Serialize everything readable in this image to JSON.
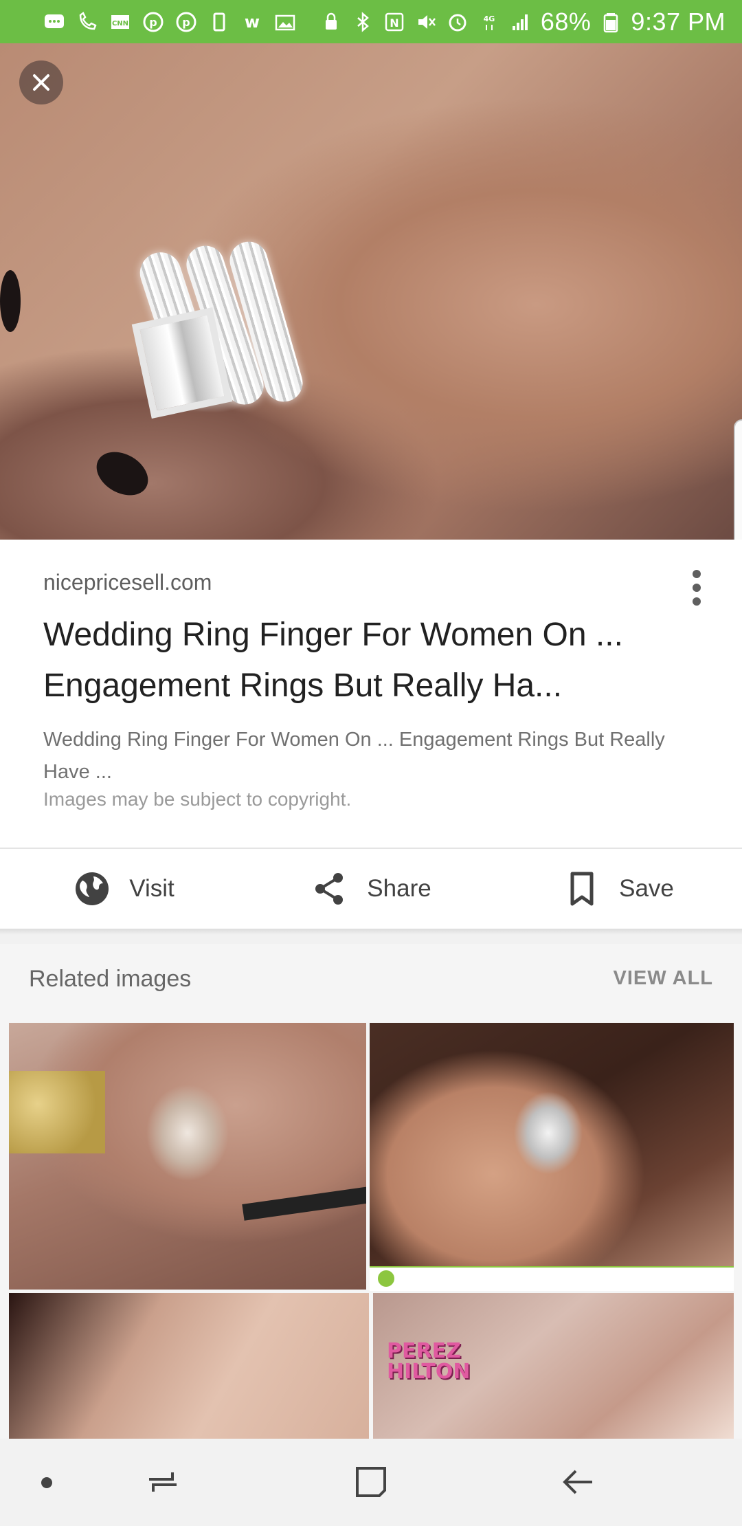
{
  "status_bar": {
    "battery_percent": "68%",
    "time": "9:37 PM",
    "icons": [
      "chat-icon",
      "missed-call-icon",
      "cnn-icon",
      "pinterest-icon",
      "pinterest-icon",
      "phone-icon",
      "w-icon",
      "gallery-icon",
      "lock-icon",
      "bluetooth-icon",
      "nfc-icon",
      "mute-icon",
      "alarm-icon",
      "4g-icon",
      "signal-icon",
      "battery-icon"
    ]
  },
  "viewer": {
    "close_icon": "close-icon"
  },
  "result": {
    "domain": "nicepricesell.com",
    "title": "Wedding Ring Finger For Women On ... Engagement Rings But Really Ha...",
    "description": "Wedding Ring Finger For Women On ... Engagement Rings But Really Have ...",
    "copyright": "Images may be subject to copyright."
  },
  "actions": {
    "visit": "Visit",
    "share": "Share",
    "save": "Save"
  },
  "related": {
    "heading": "Related images",
    "view_all": "VIEW ALL",
    "tiles": [
      {
        "watermark": ""
      },
      {
        "watermark": ""
      },
      {
        "watermark": ""
      },
      {
        "watermark": "PEREZ HILTON"
      }
    ]
  },
  "colors": {
    "status_bar": "#6cbe45",
    "title_text": "#212121",
    "secondary_text": "#5f5f5f"
  }
}
